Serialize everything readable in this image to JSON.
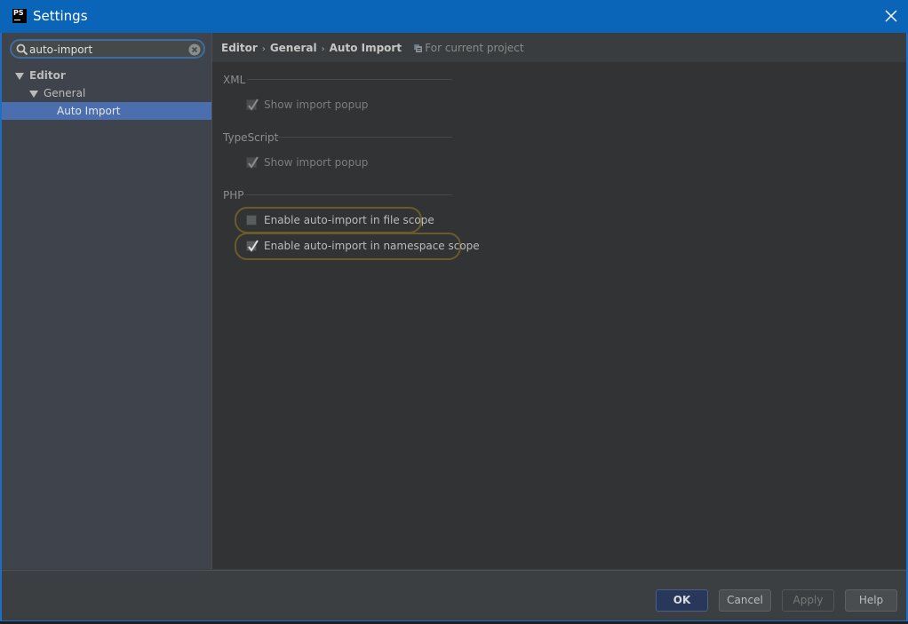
{
  "window": {
    "title": "Settings",
    "app_icon": "PS"
  },
  "sidebar": {
    "search": {
      "value": "auto-import",
      "placeholder": ""
    },
    "tree": [
      {
        "label": "Editor",
        "expanded": true,
        "level": 0
      },
      {
        "label": "General",
        "expanded": true,
        "level": 1
      },
      {
        "label": "Auto Import",
        "selected": true,
        "level": 2
      }
    ]
  },
  "breadcrumb": {
    "items": [
      "Editor",
      "General",
      "Auto Import"
    ],
    "separator": "›",
    "scope": "For current project"
  },
  "sections": [
    {
      "title": "XML",
      "options": [
        {
          "label": "Show import popup",
          "checked": true,
          "enabled": false
        }
      ]
    },
    {
      "title": "TypeScript",
      "options": [
        {
          "label": "Show import popup",
          "checked": true,
          "enabled": false
        }
      ]
    },
    {
      "title": "PHP",
      "options": [
        {
          "label": "Enable auto-import in file scope",
          "checked": false,
          "enabled": true,
          "highlighted": true
        },
        {
          "label": "Enable auto-import in namespace scope",
          "checked": true,
          "enabled": true,
          "highlighted": true
        }
      ]
    }
  ],
  "footer": {
    "ok": "OK",
    "cancel": "Cancel",
    "apply": "Apply",
    "help": "Help"
  },
  "colors": {
    "titlebar": "#0a64b7",
    "selection": "#4b6eaf",
    "highlight_border": "#6c5a2a",
    "ok_button": "#27385a"
  }
}
